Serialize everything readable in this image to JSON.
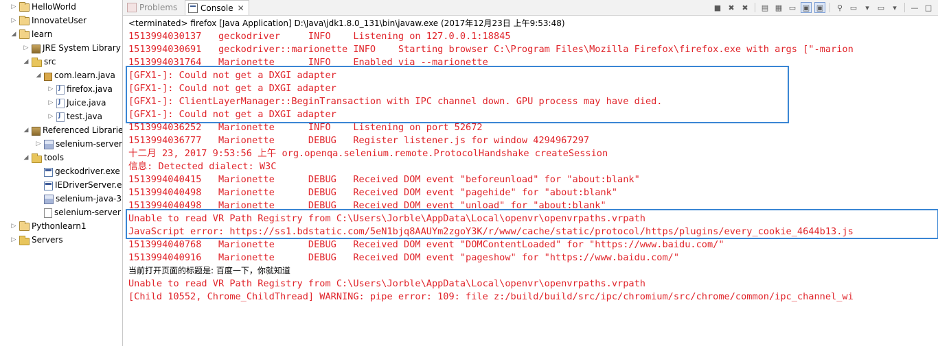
{
  "explorer": {
    "items": [
      {
        "label": "HelloWorld",
        "icon": "project-icon",
        "twisty": "▷"
      },
      {
        "label": "InnovateUser",
        "icon": "project-icon",
        "twisty": "▷"
      },
      {
        "label": "learn",
        "icon": "project-icon",
        "twisty": "◢"
      },
      {
        "label": "JRE System Library",
        "icon": "library-icon",
        "twisty": "▷"
      },
      {
        "label": "src",
        "icon": "source-folder-icon",
        "twisty": "◢"
      },
      {
        "label": "com.learn.java",
        "icon": "package-icon",
        "twisty": "◢"
      },
      {
        "label": "firefox.java",
        "icon": "java-file-icon",
        "twisty": "▷"
      },
      {
        "label": "Juice.java",
        "icon": "java-file-icon",
        "twisty": "▷"
      },
      {
        "label": "test.java",
        "icon": "java-file-icon",
        "twisty": "▷"
      },
      {
        "label": "Referenced Librarie",
        "icon": "library-icon",
        "twisty": "◢"
      },
      {
        "label": "selenium-server",
        "icon": "jar-icon",
        "twisty": "▷"
      },
      {
        "label": "tools",
        "icon": "folder-icon",
        "twisty": "◢"
      },
      {
        "label": "geckodriver.exe",
        "icon": "exe-icon",
        "twisty": ""
      },
      {
        "label": "IEDriverServer.e",
        "icon": "exe-icon",
        "twisty": ""
      },
      {
        "label": "selenium-java-3",
        "icon": "jar-icon",
        "twisty": ""
      },
      {
        "label": "selenium-server",
        "icon": "file-icon",
        "twisty": ""
      },
      {
        "label": "Pythonlearn1",
        "icon": "project-icon",
        "twisty": "▷"
      },
      {
        "label": "Servers",
        "icon": "folder-icon",
        "twisty": "▷"
      }
    ]
  },
  "tabs": {
    "problems": "Problems",
    "console": "Console",
    "close": "✕"
  },
  "toolbar": {
    "icons": [
      "stop-icon",
      "remove-launch-icon",
      "remove-all-icon",
      "clear-console-icon",
      "scroll-lock-icon",
      "word-wrap-icon",
      "show-on-stdout-icon",
      "show-on-stderr-icon",
      "pin-console-icon",
      "display-console-icon",
      "open-console-icon",
      "minimize-icon",
      "maximize-icon"
    ],
    "glyphs": [
      "■",
      "✖",
      "✖",
      "▤",
      "▦",
      "▭",
      "▣",
      "▣",
      "⚲",
      "▭",
      "▾",
      "▭",
      "▾",
      "—",
      "□"
    ]
  },
  "console": {
    "status": "<terminated> firefox [Java Application] D:\\Java\\jdk1.8.0_131\\bin\\javaw.exe (2017年12月23日 上午9:53:48)",
    "lines": [
      {
        "text": "1513994030137   geckodriver     INFO    Listening on 127.0.0.1:18845",
        "style": "red"
      },
      {
        "text": "1513994030691   geckodriver::marionette INFO    Starting browser C:\\Program Files\\Mozilla Firefox\\firefox.exe with args [\"-marion",
        "style": "red"
      },
      {
        "text": "1513994031764   Marionette      INFO    Enabled via --marionette",
        "style": "red"
      },
      {
        "text": "[GFX1-]: Could not get a DXGI adapter",
        "style": "red"
      },
      {
        "text": "[GFX1-]: Could not get a DXGI adapter",
        "style": "red"
      },
      {
        "text": "[GFX1-]: ClientLayerManager::BeginTransaction with IPC channel down. GPU process may have died.",
        "style": "red"
      },
      {
        "text": "[GFX1-]: Could not get a DXGI adapter",
        "style": "red"
      },
      {
        "text": "1513994036252   Marionette      INFO    Listening on port 52672",
        "style": "red"
      },
      {
        "text": "1513994036777   Marionette      DEBUG   Register listener.js for window 4294967297",
        "style": "red"
      },
      {
        "text": "十二月 23, 2017 9:53:56 上午 org.openqa.selenium.remote.ProtocolHandshake createSession",
        "style": "red"
      },
      {
        "text": "信息: Detected dialect: W3C",
        "style": "red"
      },
      {
        "text": "1513994040415   Marionette      DEBUG   Received DOM event \"beforeunload\" for \"about:blank\"",
        "style": "red"
      },
      {
        "text": "1513994040498   Marionette      DEBUG   Received DOM event \"pagehide\" for \"about:blank\"",
        "style": "red"
      },
      {
        "text": "1513994040498   Marionette      DEBUG   Received DOM event \"unload\" for \"about:blank\"",
        "style": "red"
      },
      {
        "text": "Unable to read VR Path Registry from C:\\Users\\Jorble\\AppData\\Local\\openvr\\openvrpaths.vrpath",
        "style": "red"
      },
      {
        "text": "JavaScript error: https://ss1.bdstatic.com/5eN1bjq8AAUYm2zgoY3K/r/www/cache/static/protocol/https/plugins/every_cookie_4644b13.js",
        "style": "red"
      },
      {
        "text": "1513994040768   Marionette      DEBUG   Received DOM event \"DOMContentLoaded\" for \"https://www.baidu.com/\"",
        "style": "red"
      },
      {
        "text": "1513994040916   Marionette      DEBUG   Received DOM event \"pageshow\" for \"https://www.baidu.com/\"",
        "style": "red"
      },
      {
        "text": "当前打开页面的标题是: 百度一下，你就知道",
        "style": "black"
      },
      {
        "text": "Unable to read VR Path Registry from C:\\Users\\Jorble\\AppData\\Local\\openvr\\openvrpaths.vrpath",
        "style": "red"
      },
      {
        "text": "[Child 10552, Chrome_ChildThread] WARNING: pipe error: 109: file z:/build/build/src/ipc/chromium/src/chrome/common/ipc_channel_wi",
        "style": "red"
      }
    ]
  },
  "colors": {
    "stderr": "#e0242a",
    "stdout": "#000000",
    "highlight_box": "#3a86d4"
  }
}
